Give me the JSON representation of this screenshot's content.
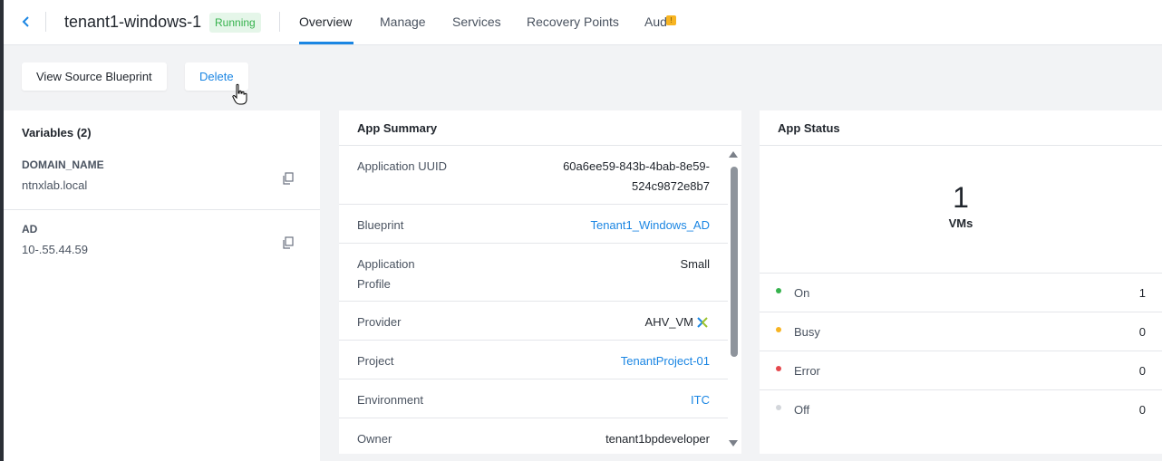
{
  "header": {
    "app_name": "tenant1-windows-1",
    "status": "Running",
    "tabs": [
      "Overview",
      "Manage",
      "Services",
      "Recovery Points",
      "Aud"
    ]
  },
  "actions": {
    "view_source": "View Source Blueprint",
    "delete": "Delete"
  },
  "variables": {
    "title": "Variables (2)",
    "items": [
      {
        "name": "DOMAIN_NAME",
        "value": "ntnxlab.local"
      },
      {
        "name": "AD",
        "value": "10-.55.44.59"
      }
    ]
  },
  "summary": {
    "title": "App Summary",
    "rows": [
      {
        "label": "Application UUID",
        "value_line1": "60a6ee59-843b-4bab-8e59-",
        "value_line2": "524c9872e8b7"
      },
      {
        "label": "Blueprint",
        "value": "Tenant1_Windows_AD"
      },
      {
        "label_line1": "Application",
        "label_line2": "Profile",
        "value": "Small"
      },
      {
        "label": "Provider",
        "value": "AHV_VM"
      },
      {
        "label": "Project",
        "value": "TenantProject-01"
      },
      {
        "label": "Environment",
        "value": "ITC"
      },
      {
        "label": "Owner",
        "value": "tenant1bpdeveloper"
      }
    ]
  },
  "status_panel": {
    "title": "App Status",
    "vm_count": "1",
    "vm_label": "VMs",
    "states": [
      {
        "label": "On",
        "count": "1",
        "color": "#36b24d"
      },
      {
        "label": "Busy",
        "count": "0",
        "color": "#f7b422"
      },
      {
        "label": "Error",
        "count": "0",
        "color": "#e5484d"
      },
      {
        "label": "Off",
        "count": "0",
        "color": "#d3d6db"
      }
    ]
  },
  "colors": {
    "accent": "#1b86e3",
    "running_badge_bg": "#e5f6e9",
    "running_badge_text": "#36b24d"
  }
}
